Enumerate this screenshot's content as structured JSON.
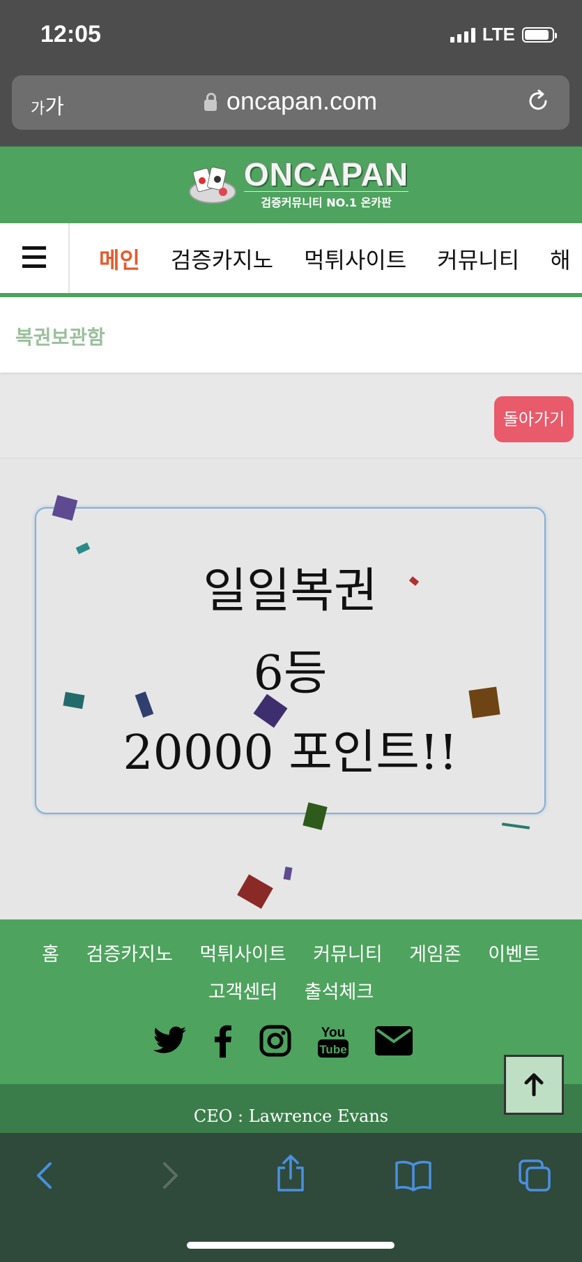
{
  "status_bar": {
    "time": "12:05",
    "network": "LTE",
    "battery_level": 0.8
  },
  "url_bar": {
    "text_size_label_small": "가",
    "text_size_label_large": "가",
    "url": "oncapan.com"
  },
  "header": {
    "logo_text": "ONCAPAN",
    "logo_tagline": "검증커뮤니티 NO.1 온카판"
  },
  "nav": {
    "items": [
      {
        "label": "메인",
        "active": true
      },
      {
        "label": "검증카지노"
      },
      {
        "label": "먹튀사이트"
      },
      {
        "label": "커뮤니티"
      },
      {
        "label": "해"
      }
    ]
  },
  "page": {
    "title": "복권보관함",
    "back_button": "돌아가기"
  },
  "result": {
    "line1": "일일복권",
    "line2": "6등",
    "line3": "20000 포인트!!"
  },
  "footer": {
    "links_row1": [
      "홈",
      "검증카지노",
      "먹튀사이트",
      "커뮤니티",
      "게임존",
      "이벤트"
    ],
    "links_row2": [
      "고객센터",
      "출석체크"
    ],
    "social_icons": [
      "twitter-icon",
      "facebook-icon",
      "instagram-icon",
      "youtube-icon",
      "mail-icon"
    ],
    "ceo": "CEO : Lawrence Evans"
  },
  "colors": {
    "brand_green": "#4ea35e",
    "nav_active": "#e65a2c",
    "back_button": "#e95a6a"
  }
}
